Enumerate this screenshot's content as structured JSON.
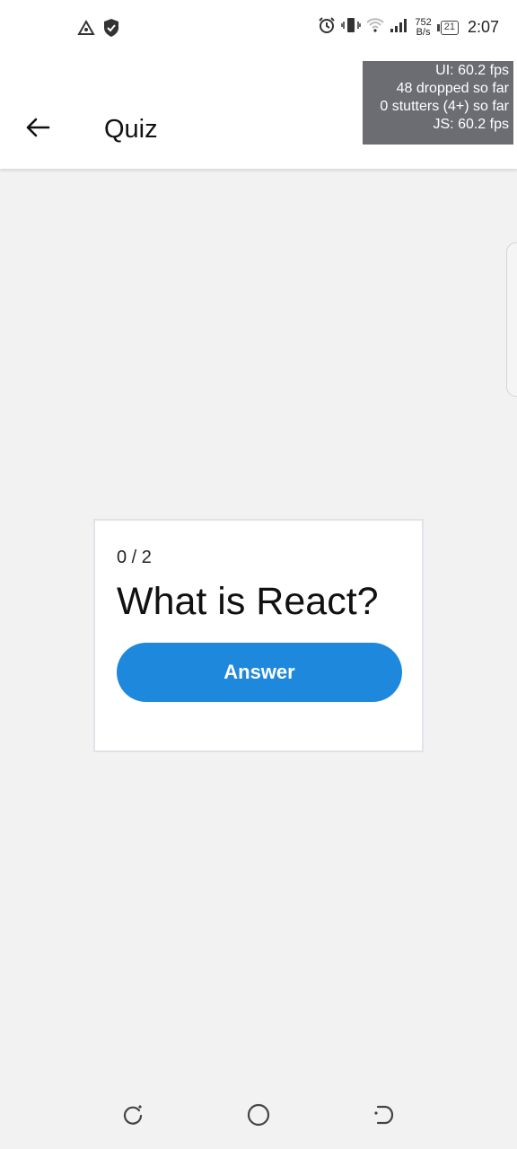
{
  "status_bar": {
    "left_icons": [
      "android-notification-icon",
      "shield-icon"
    ],
    "right_icons": [
      "alarm-icon",
      "vibrate-icon",
      "wifi-icon",
      "signal-icon"
    ],
    "speed_value": "752",
    "speed_unit": "B/s",
    "battery_level": "21",
    "time": "2:07"
  },
  "header": {
    "back_icon": "arrow-left-icon",
    "title": "Quiz"
  },
  "perf_overlay": {
    "ui_fps": "UI: 60.2 fps",
    "dropped": "48 dropped so far",
    "stutters": "0 stutters (4+) so far",
    "js_fps": "JS: 60.2 fps"
  },
  "quiz": {
    "progress": "0 / 2",
    "question": "What is React?",
    "answer_label": "Answer",
    "accent_color": "#1e88dd"
  },
  "nav_bar": {
    "items": [
      "recent-apps-icon",
      "home-icon",
      "back-nav-icon"
    ]
  }
}
